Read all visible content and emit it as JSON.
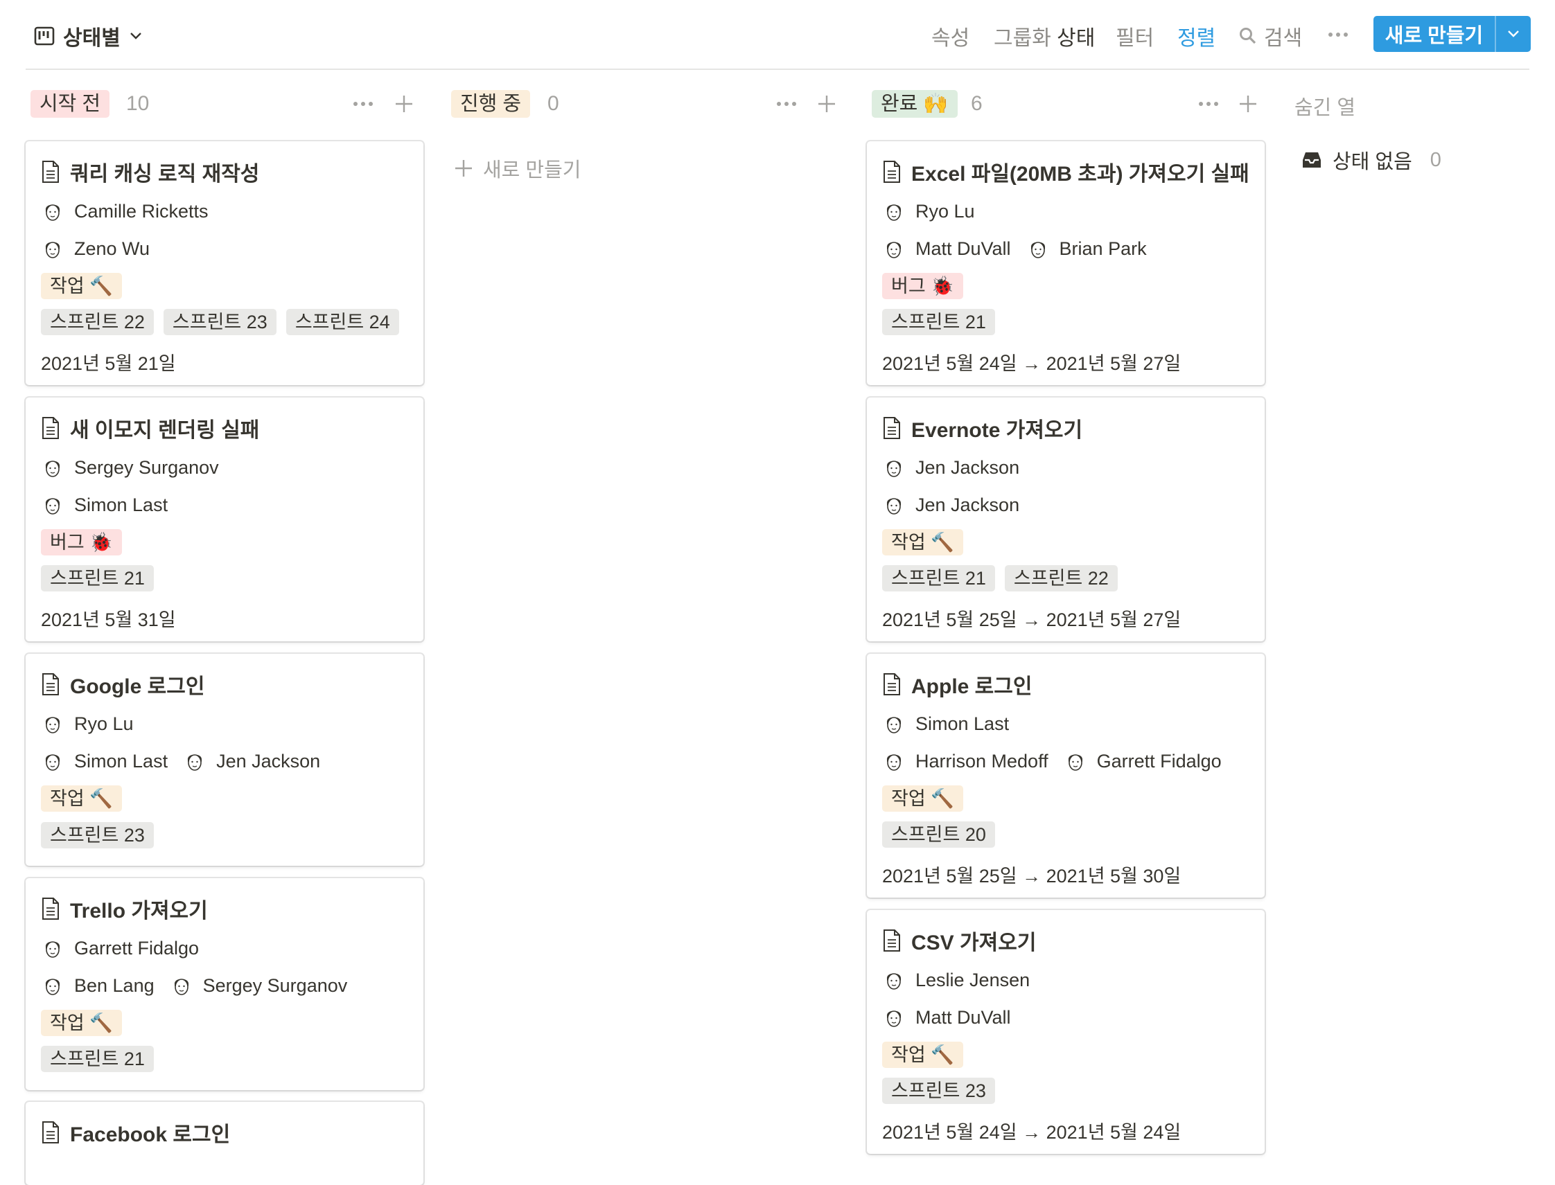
{
  "toolbar": {
    "view_name": "상태별",
    "properties": "속성",
    "group_by_label": "그룹화",
    "group_by_value": "상태",
    "filter": "필터",
    "sort": "정렬",
    "search": "검색",
    "new_button": "새로 만들기"
  },
  "columns": [
    {
      "status": "시작 전",
      "count": "10",
      "color": "#fde0e0"
    },
    {
      "status": "진행 중",
      "count": "0",
      "color": "#fbeedb",
      "new_label": "새로 만들기"
    },
    {
      "status": "완료 🙌",
      "count": "6",
      "color": "#ddeddf"
    }
  ],
  "hidden": {
    "title": "숨긴 열",
    "no_status": "상태 없음",
    "count": "0"
  },
  "cards": [
    {
      "title": "쿼리 캐싱 로직 재작성",
      "people": [
        "Camille Ricketts",
        "Zeno Wu"
      ],
      "type": "작업 🔨",
      "sprints": [
        "스프린트 22",
        "스프린트 23",
        "스프린트 24"
      ],
      "date": "2021년 5월 21일"
    },
    {
      "title": "새 이모지 렌더링 실패",
      "people": [
        "Sergey Surganov",
        "Simon Last"
      ],
      "type": "버그 🐞",
      "sprints": [
        "스프린트 21"
      ],
      "date": "2021년 5월 31일"
    },
    {
      "title": "Google 로그인",
      "people": [
        "Ryo Lu",
        "Simon Last",
        "Jen Jackson"
      ],
      "type": "작업 🔨",
      "sprints": [
        "스프린트 23"
      ]
    },
    {
      "title": "Trello 가져오기",
      "people": [
        "Garrett Fidalgo",
        "Ben Lang",
        "Sergey Surganov"
      ],
      "type": "작업 🔨",
      "sprints": [
        "스프린트 21"
      ]
    },
    {
      "title": "Facebook 로그인"
    },
    {
      "title": "Excel 파일(20MB 초과) 가져오기 실패",
      "people": [
        "Ryo Lu",
        "Matt DuVall",
        "Brian Park"
      ],
      "type": "버그 🐞",
      "sprints": [
        "스프린트 21"
      ],
      "date": "2021년 5월 24일 → 2021년 5월 27일"
    },
    {
      "title": "Evernote 가져오기",
      "people": [
        "Jen Jackson",
        "Jen Jackson"
      ],
      "type": "작업 🔨",
      "sprints": [
        "스프린트 21",
        "스프린트 22"
      ],
      "date": "2021년 5월 25일 → 2021년 5월 27일"
    },
    {
      "title": "Apple 로그인",
      "people": [
        "Simon Last",
        "Harrison Medoff",
        "Garrett Fidalgo"
      ],
      "type": "작업 🔨",
      "sprints": [
        "스프린트 20"
      ],
      "date": "2021년 5월 25일 → 2021년 5월 30일"
    },
    {
      "title": "CSV 가져오기",
      "people": [
        "Leslie Jensen",
        "Matt DuVall"
      ],
      "type": "작업 🔨",
      "sprints": [
        "스프린트 23"
      ],
      "date": "2021년 5월 24일 → 2021년 5월 24일"
    }
  ]
}
